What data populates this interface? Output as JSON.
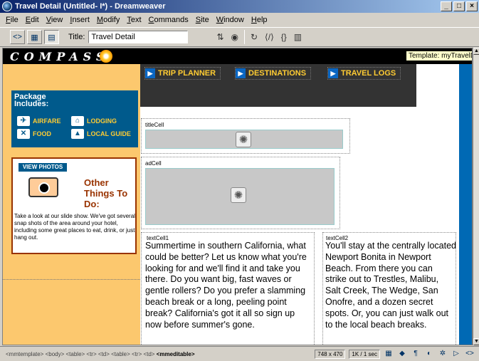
{
  "window": {
    "title": "Travel Detail (Untitled- I*) - Dreamweaver",
    "controls": [
      "_",
      "□",
      "×"
    ]
  },
  "menu": [
    "File",
    "Edit",
    "View",
    "Insert",
    "Modify",
    "Text",
    "Commands",
    "Site",
    "Window",
    "Help"
  ],
  "toolbar": {
    "title_label": "Title:",
    "title_value": "Travel Detail",
    "view_icons": [
      "code-view-icon",
      "split-view-icon",
      "design-view-icon"
    ],
    "tool_icons": [
      "file-management-icon",
      "preview-browser-icon",
      "refresh-icon",
      "reference-icon",
      "code-navigation-icon",
      "view-options-icon"
    ]
  },
  "page": {
    "logo": "COMPASS",
    "template_tag": "Template: myTravelDetail",
    "nav": [
      "TRIP PLANNER",
      "DESTINATIONS",
      "TRAVEL LOGS"
    ],
    "package_title_1": "Package",
    "package_title_2": "Includes:",
    "package_items": [
      "AIRFARE",
      "LODGING",
      "FOOD",
      "LOCAL GUIDE"
    ],
    "view_photos": "VIEW PHOTOS",
    "other_things": [
      "Other",
      "Things To",
      "Do:"
    ],
    "photos_text": "Take a look at our slide show. We've got several snap shots of the area around your hotel, including some great places to eat, drink, or just hang out.",
    "title_cell_label": "titleCell",
    "ad_cell_label": "adCell",
    "text_cell1_label": "textCell1",
    "text_cell2_label": "textCell2",
    "text_cell1": "Summertime in southern California, what could be better? Let us know what you're looking for and we'll find it and take you there. Do you want big, fast waves or gentle rollers? Do you prefer a slamming beach break or a long, peeling point break? California's got it all so sign up now before summer's gone.",
    "text_cell2": "You'll stay at the centrally located Newport Bonita in Newport Beach. From there you can strike out to Trestles, Malibu, Salt Creek, The Wedge, San Onofre, and a dozen secret spots. Or, you can just walk out to the local beach breaks."
  },
  "status": {
    "tag_path": "<mmtemplate> <body> <table> <tr> <td> <table> <tr> <td>",
    "tag_selected": "<mmeditable>",
    "window_size": "748 x 470",
    "download": "1K / 1 sec"
  },
  "colors": {
    "title_bar": "#0a246a",
    "orange": "#fcc86e",
    "nav_text": "#ffcc33",
    "blue": "#0069b4",
    "dark": "#333333"
  }
}
